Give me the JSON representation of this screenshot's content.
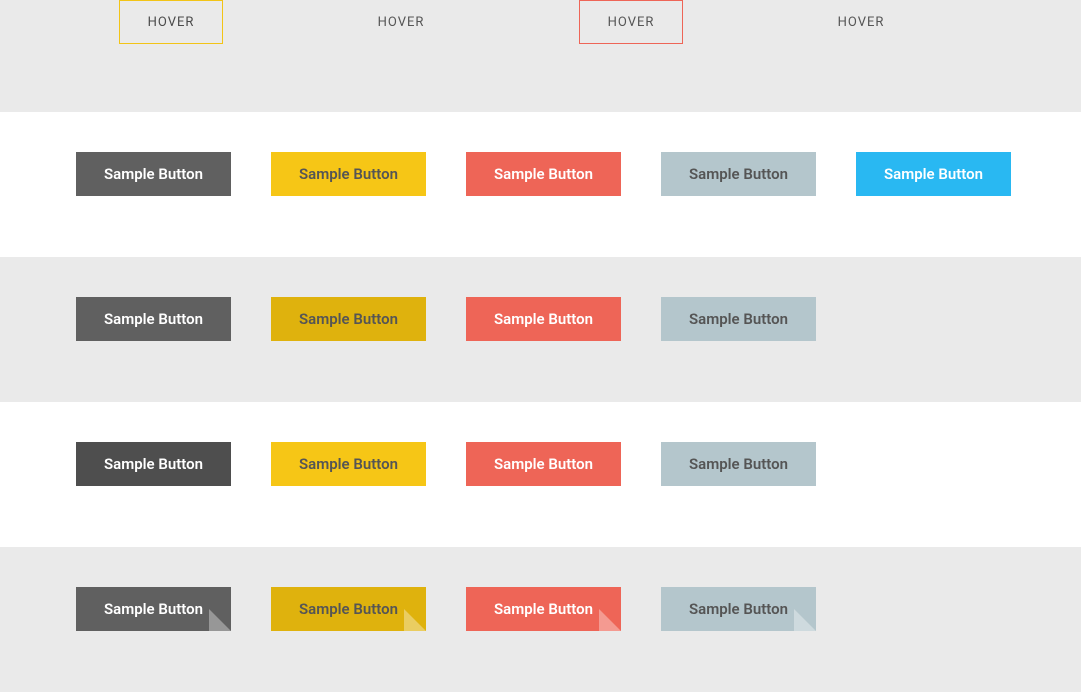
{
  "hoverRow": {
    "items": [
      {
        "label": "HOVER"
      },
      {
        "label": "HOVER"
      },
      {
        "label": "HOVER"
      },
      {
        "label": "HOVER"
      }
    ]
  },
  "row1": {
    "b1": "Sample Button",
    "b2": "Sample Button",
    "b3": "Sample Button",
    "b4": "Sample Button",
    "b5": "Sample Button"
  },
  "row2": {
    "b1": "Sample Button",
    "b2": "Sample Button",
    "b3": "Sample Button",
    "b4": "Sample Button"
  },
  "row3": {
    "b1": "Sample Button",
    "b2": "Sample Button",
    "b3": "Sample Button",
    "b4": "Sample Button"
  },
  "row4": {
    "b1": "Sample Button",
    "b2": "Sample Button",
    "b3": "Sample Button",
    "b4": "Sample Button"
  }
}
